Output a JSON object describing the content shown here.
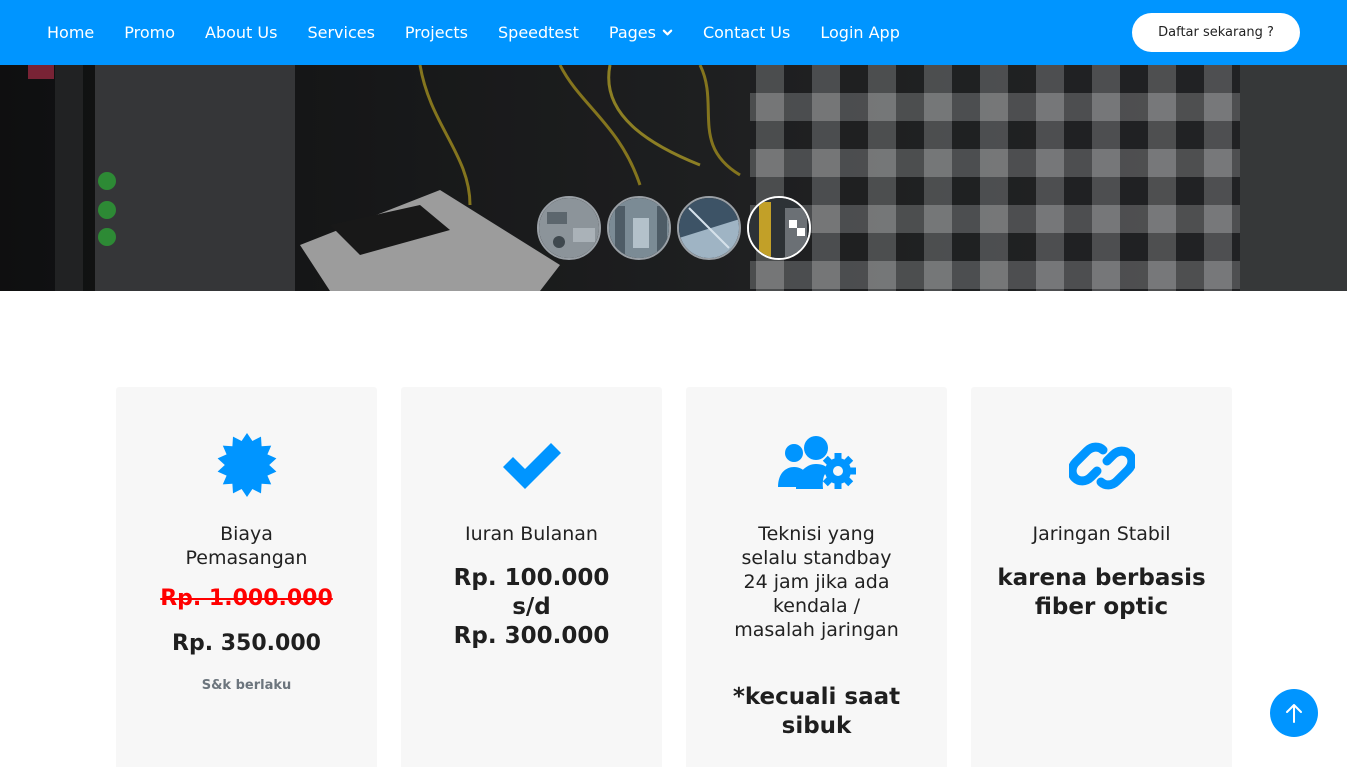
{
  "nav": {
    "items": [
      {
        "label": "Home"
      },
      {
        "label": "Promo"
      },
      {
        "label": "About Us"
      },
      {
        "label": "Services"
      },
      {
        "label": "Projects"
      },
      {
        "label": "Speedtest"
      },
      {
        "label": "Pages"
      },
      {
        "label": "Contact Us"
      },
      {
        "label": "Login App"
      }
    ],
    "cta_label": "Daftar sekarang ?"
  },
  "hero": {
    "thumbnail_count": 4,
    "active_thumbnail": 4
  },
  "cards": [
    {
      "icon": "certificate-icon",
      "title": "Biaya Pemasangan",
      "old_price": "Rp. 1.000.000",
      "new_price": "Rp. 350.000",
      "note": "S&k berlaku"
    },
    {
      "icon": "check-icon",
      "title": "Iuran Bulanan",
      "line1": "Rp. 100.000",
      "line2": "s/d",
      "line3": "Rp. 300.000"
    },
    {
      "icon": "users-cog-icon",
      "title": "Teknisi yang selalu standbay 24 jam jika ada kendala / masalah jaringan",
      "subtitle": "*kecuali saat sibuk"
    },
    {
      "icon": "link-icon",
      "title": "Jaringan Stabil",
      "line1": "karena berbasis fiber optic"
    }
  ],
  "colors": {
    "primary": "#0095ff",
    "strike": "#ff0000",
    "card_bg": "#f7f7f7"
  }
}
